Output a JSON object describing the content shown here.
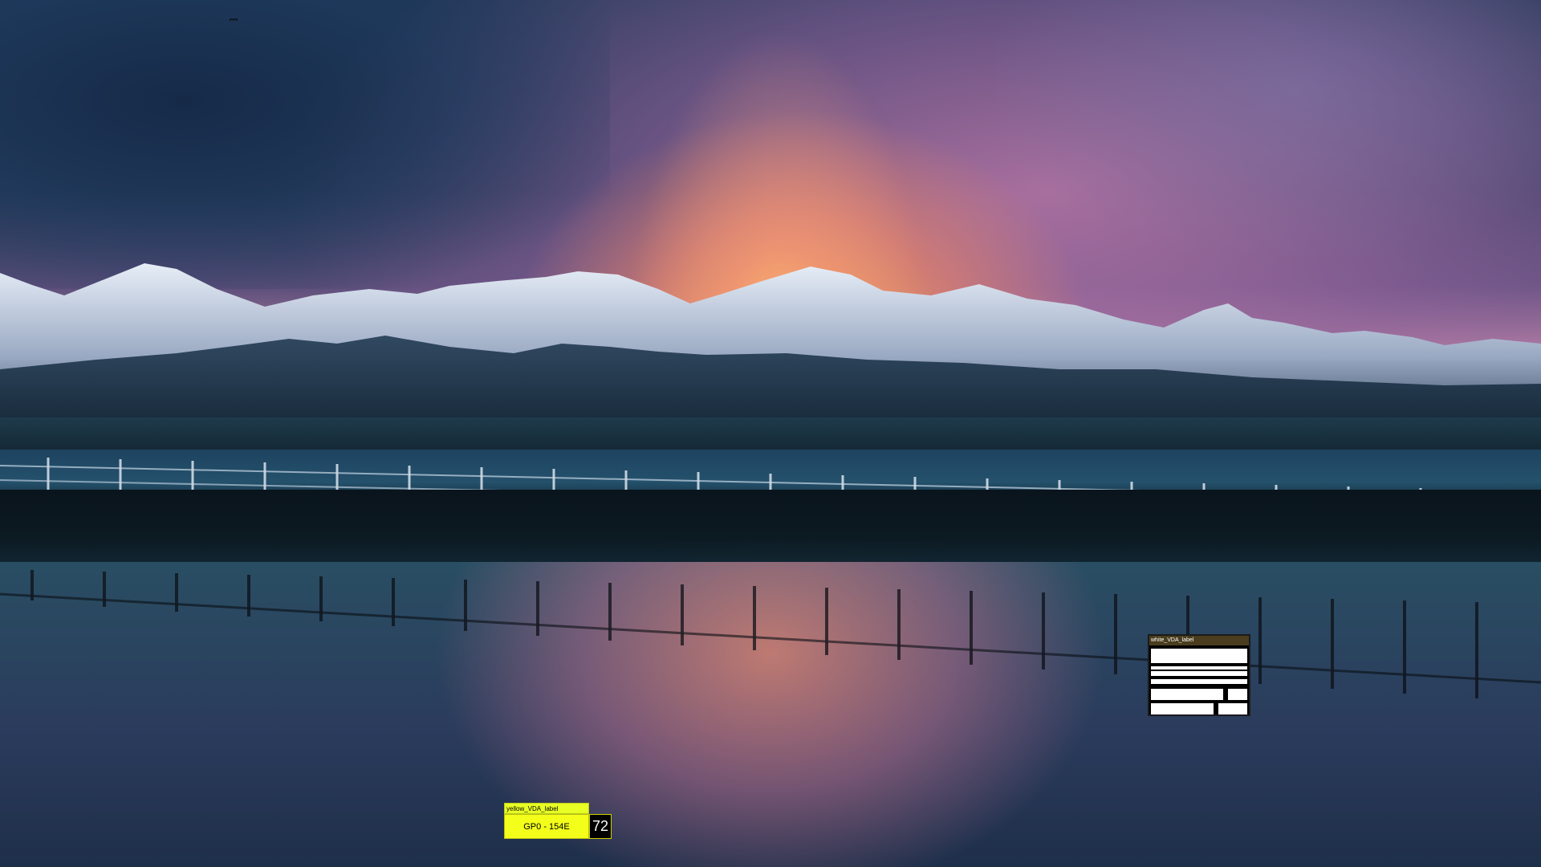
{
  "desktop": {
    "wallpaper_description_colors": {
      "sky_top": "#243a5a",
      "sunset_glow": "#ffb070",
      "mountain_snow": "#d9e2ee",
      "water": "#294e63"
    },
    "icons": {
      "bird": "bird-icon"
    }
  },
  "overlays": {
    "yellow_label": {
      "caption": "yellow_VDA_label",
      "main_text": "GP0 - 154E",
      "count": "72",
      "color": "#f3ff1b"
    },
    "white_label": {
      "caption": "white_VDA_label",
      "text": "",
      "color": "#ffffff"
    }
  }
}
